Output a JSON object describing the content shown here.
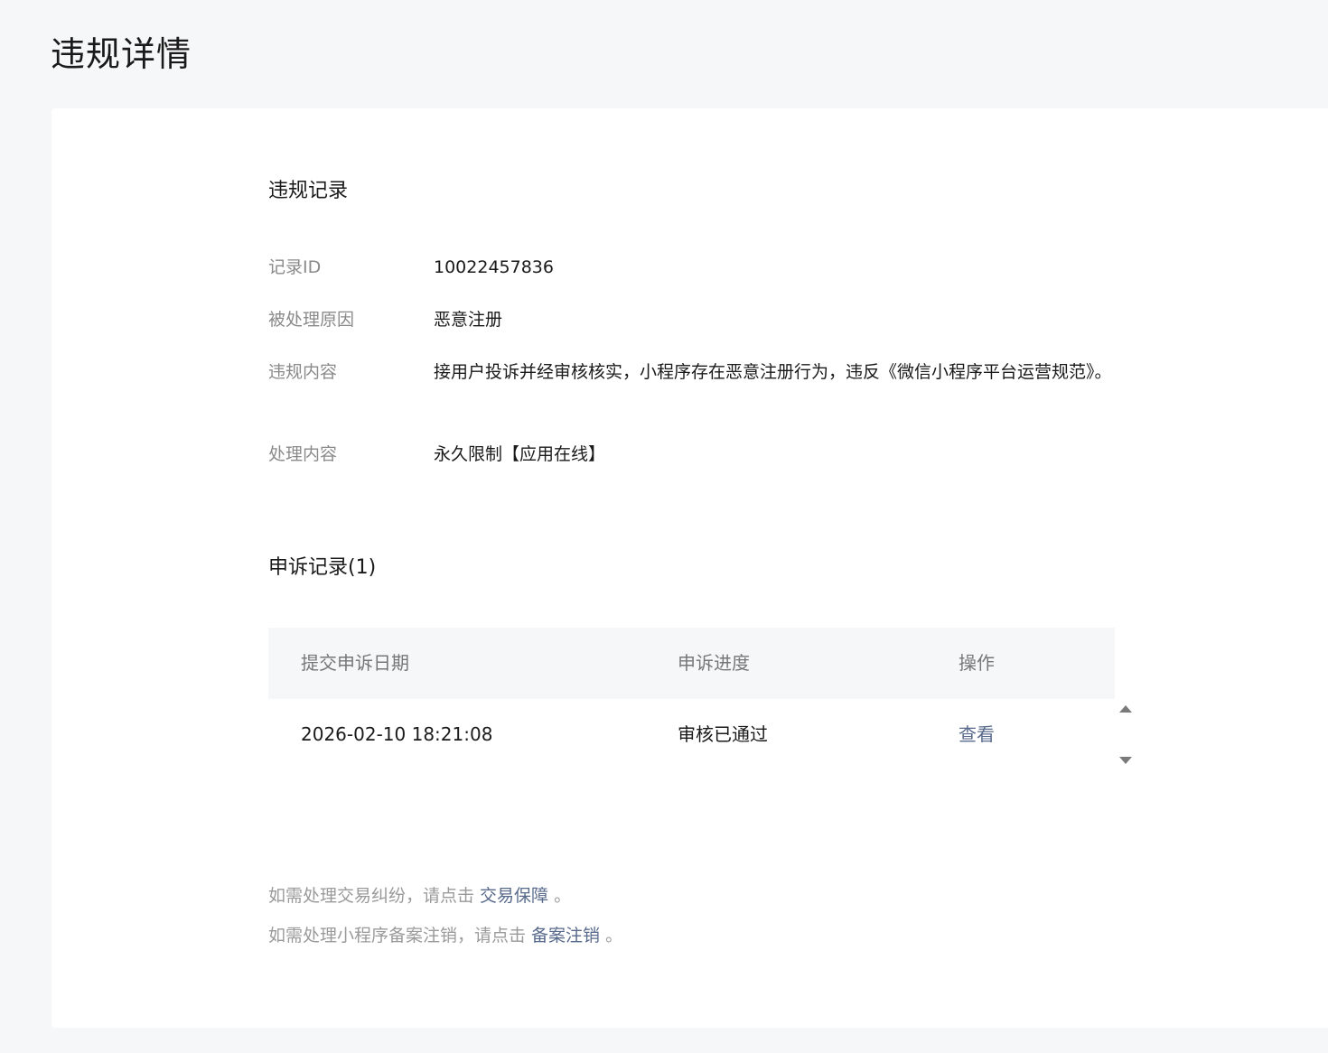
{
  "page": {
    "title": "违规详情"
  },
  "record": {
    "section_title": "违规记录",
    "rows": [
      {
        "label": "记录ID",
        "value": "10022457836"
      },
      {
        "label": "被处理原因",
        "value": "恶意注册"
      },
      {
        "label": "违规内容",
        "value": "接用户投诉并经审核核实，小程序存在恶意注册行为，违反《微信小程序平台运营规范》。"
      },
      {
        "label": "处理内容",
        "value": "永久限制【应用在线】"
      }
    ]
  },
  "appeal": {
    "section_title": "申诉记录(1)",
    "columns": [
      "提交申诉日期",
      "申诉进度",
      "操作"
    ],
    "rows": [
      {
        "date": "2026-02-10 18:21:08",
        "status": "审核已通过",
        "action": "查看"
      }
    ]
  },
  "footer": {
    "line1_prefix": "如需处理交易纠纷，请点击 ",
    "line1_link": "交易保障",
    "line1_suffix": " 。",
    "line2_prefix": "如需处理小程序备案注销，请点击 ",
    "line2_link": "备案注销",
    "line2_suffix": " 。"
  },
  "colors": {
    "background": "#f6f7f9",
    "card": "#ffffff",
    "link": "#586a8c",
    "muted_text": "#8a8a8a"
  }
}
